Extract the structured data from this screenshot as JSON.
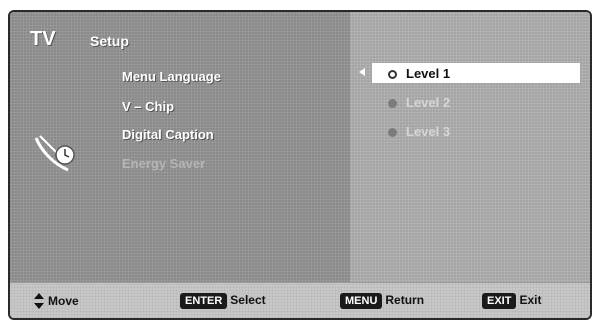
{
  "header": {
    "tv": "TV",
    "setup": "Setup"
  },
  "menu": [
    {
      "label": "Menu Language",
      "enabled": true
    },
    {
      "label": "V – Chip",
      "enabled": true
    },
    {
      "label": "Digital Caption",
      "enabled": true
    },
    {
      "label": "Energy Saver",
      "enabled": false
    }
  ],
  "options": [
    {
      "label": "Level 1",
      "selected": true
    },
    {
      "label": "Level 2",
      "selected": false
    },
    {
      "label": "Level 3",
      "selected": false
    }
  ],
  "footer": {
    "move": "Move",
    "enter_key": "ENTER",
    "enter_label": "Select",
    "menu_key": "MENU",
    "menu_label": "Return",
    "exit_key": "EXIT",
    "exit_label": "Exit"
  },
  "icons": {
    "setup": "satellite-dish-clock-icon",
    "updown": "up-down-arrow-icon",
    "selector": "left-arrow-icon"
  }
}
